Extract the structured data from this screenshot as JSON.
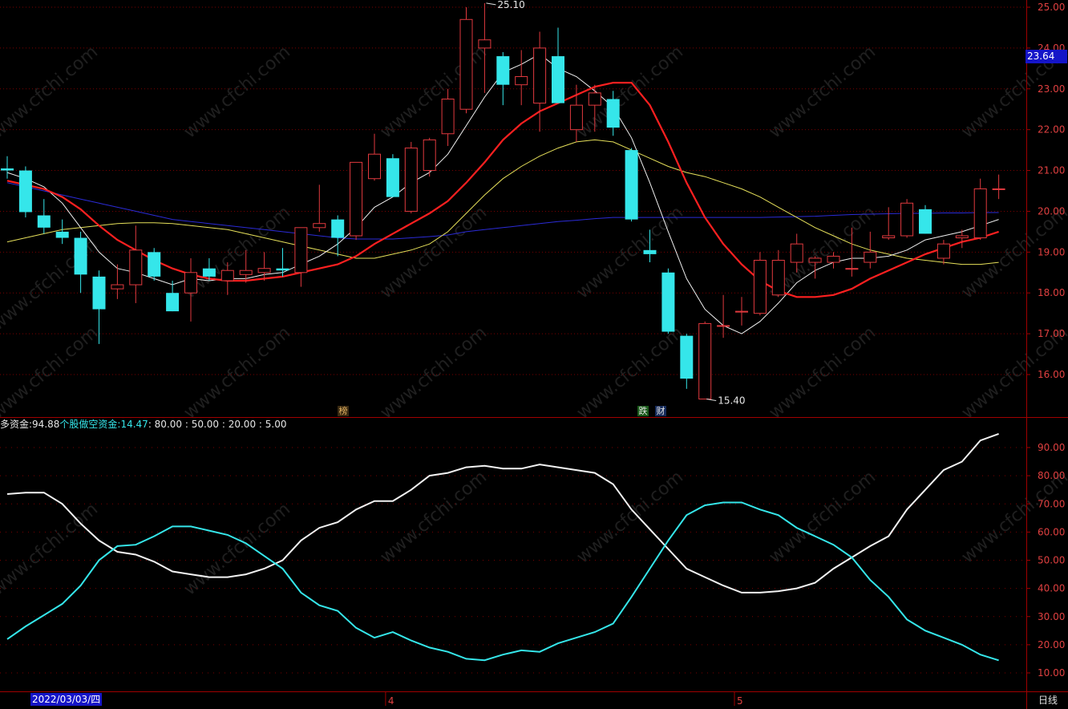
{
  "watermark": "www.cfchi.com",
  "colors": {
    "background": "#000000",
    "up": "#e0393e",
    "down": "#35e6ea",
    "grid": "#7a0000",
    "axis": "#a00000",
    "ma5": "#f0f0f0",
    "ma10": "#ff2020",
    "ma20": "#e6e05a",
    "ma60": "#2b2bd6",
    "axis_text": "#e04040"
  },
  "legend": {
    "prefix": "多资金: ",
    "long_value": "94.88",
    "short_label": " 个股做空资金: ",
    "short_value": "14.47",
    "levels_text": " : 80.00 : 50.00 : 20.00 : 5.00"
  },
  "last_price": "23.64",
  "period": "日线",
  "cursor_date": "2022/03/03/四",
  "event_markers": {
    "bang": "榜",
    "die": "跌",
    "cai": "财"
  },
  "chart_data": [
    {
      "type": "candlestick",
      "ylim": [
        15.0,
        25.2
      ],
      "y_ticks": [
        16.0,
        17.0,
        18.0,
        19.0,
        20.0,
        21.0,
        22.0,
        23.0,
        24.0,
        25.0
      ],
      "y_tick_labels": [
        "16.00",
        "17.00",
        "18.00",
        "19.00",
        "20.00",
        "21.00",
        "22.00",
        "23.00",
        "24.00",
        "25.00"
      ],
      "x_tick_labels": [
        "4",
        "5"
      ],
      "x_tick_index": [
        21,
        40
      ],
      "annotations": [
        {
          "text": "25.10",
          "index": 26,
          "value": 25.1
        },
        {
          "text": "15.40",
          "index": 38,
          "value": 15.4
        }
      ],
      "candles": [
        {
          "o": 21.05,
          "h": 21.35,
          "l": 20.8,
          "c": 21.0
        },
        {
          "o": 21.0,
          "h": 21.1,
          "l": 19.85,
          "c": 19.98
        },
        {
          "o": 19.9,
          "h": 20.3,
          "l": 19.45,
          "c": 19.6
        },
        {
          "o": 19.5,
          "h": 19.8,
          "l": 19.2,
          "c": 19.35
        },
        {
          "o": 19.35,
          "h": 19.5,
          "l": 18.0,
          "c": 18.45
        },
        {
          "o": 18.4,
          "h": 18.55,
          "l": 16.75,
          "c": 17.6
        },
        {
          "o": 18.1,
          "h": 18.7,
          "l": 17.85,
          "c": 18.2
        },
        {
          "o": 18.2,
          "h": 19.65,
          "l": 17.75,
          "c": 19.05
        },
        {
          "o": 19.0,
          "h": 19.1,
          "l": 18.3,
          "c": 18.4
        },
        {
          "o": 18.0,
          "h": 18.3,
          "l": 17.55,
          "c": 17.55
        },
        {
          "o": 18.0,
          "h": 18.85,
          "l": 17.3,
          "c": 18.5
        },
        {
          "o": 18.6,
          "h": 18.85,
          "l": 18.3,
          "c": 18.4
        },
        {
          "o": 18.3,
          "h": 18.75,
          "l": 17.95,
          "c": 18.55
        },
        {
          "o": 18.45,
          "h": 19.05,
          "l": 18.25,
          "c": 18.55
        },
        {
          "o": 18.5,
          "h": 19.0,
          "l": 18.3,
          "c": 18.6
        },
        {
          "o": 18.6,
          "h": 19.1,
          "l": 18.4,
          "c": 18.55
        },
        {
          "o": 18.5,
          "h": 19.6,
          "l": 18.15,
          "c": 19.6
        },
        {
          "o": 19.6,
          "h": 20.65,
          "l": 19.5,
          "c": 19.7
        },
        {
          "o": 19.8,
          "h": 19.9,
          "l": 18.9,
          "c": 19.35
        },
        {
          "o": 19.4,
          "h": 21.2,
          "l": 19.3,
          "c": 21.2
        },
        {
          "o": 20.8,
          "h": 21.9,
          "l": 20.75,
          "c": 21.4
        },
        {
          "o": 21.3,
          "h": 21.4,
          "l": 20.35,
          "c": 20.35
        },
        {
          "o": 20.0,
          "h": 21.7,
          "l": 19.95,
          "c": 21.55
        },
        {
          "o": 21.0,
          "h": 21.8,
          "l": 20.85,
          "c": 21.75
        },
        {
          "o": 21.9,
          "h": 23.0,
          "l": 21.6,
          "c": 22.75
        },
        {
          "o": 22.5,
          "h": 25.0,
          "l": 22.4,
          "c": 24.7
        },
        {
          "o": 24.0,
          "h": 25.1,
          "l": 22.9,
          "c": 24.2
        },
        {
          "o": 23.8,
          "h": 23.9,
          "l": 22.6,
          "c": 23.1
        },
        {
          "o": 23.1,
          "h": 23.95,
          "l": 22.6,
          "c": 23.3
        },
        {
          "o": 22.65,
          "h": 24.4,
          "l": 21.95,
          "c": 24.0
        },
        {
          "o": 23.8,
          "h": 24.5,
          "l": 22.65,
          "c": 22.65
        },
        {
          "o": 22.0,
          "h": 23.1,
          "l": 21.7,
          "c": 22.6
        },
        {
          "o": 22.6,
          "h": 23.1,
          "l": 21.95,
          "c": 22.9
        },
        {
          "o": 22.75,
          "h": 22.95,
          "l": 21.85,
          "c": 22.05
        },
        {
          "o": 21.5,
          "h": 21.55,
          "l": 19.75,
          "c": 19.8
        },
        {
          "o": 19.05,
          "h": 19.55,
          "l": 18.75,
          "c": 18.95
        },
        {
          "o": 18.5,
          "h": 18.6,
          "l": 17.0,
          "c": 17.05
        },
        {
          "o": 16.95,
          "h": 17.0,
          "l": 15.65,
          "c": 15.9
        },
        {
          "o": 15.4,
          "h": 17.3,
          "l": 15.4,
          "c": 17.25
        },
        {
          "o": 17.2,
          "h": 17.95,
          "l": 16.9,
          "c": 17.2
        },
        {
          "o": 17.55,
          "h": 17.9,
          "l": 17.2,
          "c": 17.55
        },
        {
          "o": 17.5,
          "h": 19.0,
          "l": 17.45,
          "c": 18.8
        },
        {
          "o": 17.95,
          "h": 19.05,
          "l": 17.9,
          "c": 18.8
        },
        {
          "o": 18.75,
          "h": 19.45,
          "l": 18.5,
          "c": 19.2
        },
        {
          "o": 18.75,
          "h": 18.9,
          "l": 18.35,
          "c": 18.85
        },
        {
          "o": 18.75,
          "h": 19.0,
          "l": 18.6,
          "c": 18.9
        },
        {
          "o": 18.6,
          "h": 19.6,
          "l": 18.4,
          "c": 18.6
        },
        {
          "o": 18.75,
          "h": 19.5,
          "l": 18.6,
          "c": 19.0
        },
        {
          "o": 19.35,
          "h": 20.1,
          "l": 19.3,
          "c": 19.4
        },
        {
          "o": 19.4,
          "h": 20.3,
          "l": 19.35,
          "c": 20.2
        },
        {
          "o": 20.05,
          "h": 20.15,
          "l": 19.45,
          "c": 19.45
        },
        {
          "o": 18.85,
          "h": 19.3,
          "l": 18.7,
          "c": 19.2
        },
        {
          "o": 19.35,
          "h": 19.55,
          "l": 19.1,
          "c": 19.4
        },
        {
          "o": 19.35,
          "h": 20.8,
          "l": 19.3,
          "c": 20.55
        },
        {
          "o": 20.55,
          "h": 20.9,
          "l": 20.3,
          "c": 20.55
        }
      ],
      "series": [
        {
          "key": "ma5",
          "values": [
            20.95,
            20.8,
            20.6,
            20.2,
            19.6,
            19.0,
            18.6,
            18.5,
            18.35,
            18.2,
            18.35,
            18.3,
            18.35,
            18.35,
            18.45,
            18.5,
            18.7,
            18.9,
            19.2,
            19.6,
            20.1,
            20.35,
            20.7,
            20.95,
            21.4,
            22.1,
            22.8,
            23.4,
            23.6,
            23.85,
            23.5,
            23.3,
            22.95,
            22.55,
            21.8,
            20.7,
            19.5,
            18.35,
            17.6,
            17.2,
            17.0,
            17.3,
            17.75,
            18.25,
            18.55,
            18.75,
            18.85,
            18.85,
            18.9,
            19.05,
            19.3,
            19.4,
            19.5,
            19.65,
            19.8
          ]
        },
        {
          "key": "ma10",
          "values": [
            20.75,
            20.65,
            20.55,
            20.35,
            20.05,
            19.65,
            19.3,
            19.05,
            18.8,
            18.6,
            18.45,
            18.35,
            18.3,
            18.3,
            18.35,
            18.4,
            18.5,
            18.6,
            18.7,
            18.9,
            19.2,
            19.45,
            19.7,
            19.95,
            20.25,
            20.7,
            21.2,
            21.75,
            22.15,
            22.45,
            22.65,
            22.85,
            23.05,
            23.15,
            23.15,
            22.6,
            21.7,
            20.7,
            19.85,
            19.2,
            18.7,
            18.3,
            18.05,
            17.9,
            17.9,
            17.95,
            18.1,
            18.35,
            18.55,
            18.75,
            18.95,
            19.1,
            19.25,
            19.35,
            19.5
          ]
        },
        {
          "key": "ma20",
          "values": [
            19.25,
            19.35,
            19.45,
            19.55,
            19.6,
            19.65,
            19.7,
            19.72,
            19.72,
            19.7,
            19.65,
            19.6,
            19.55,
            19.45,
            19.35,
            19.25,
            19.15,
            19.05,
            18.95,
            18.85,
            18.85,
            18.95,
            19.05,
            19.2,
            19.5,
            19.95,
            20.4,
            20.8,
            21.1,
            21.35,
            21.55,
            21.7,
            21.75,
            21.7,
            21.5,
            21.3,
            21.1,
            20.95,
            20.85,
            20.7,
            20.55,
            20.35,
            20.1,
            19.85,
            19.6,
            19.4,
            19.2,
            19.05,
            18.95,
            18.85,
            18.8,
            18.75,
            18.7,
            18.7,
            18.75
          ]
        },
        {
          "key": "ma60",
          "values": [
            20.7,
            20.6,
            20.5,
            20.4,
            20.3,
            20.2,
            20.1,
            20.0,
            19.9,
            19.8,
            19.75,
            19.7,
            19.65,
            19.6,
            19.55,
            19.5,
            19.45,
            19.4,
            19.35,
            19.32,
            19.32,
            19.32,
            19.35,
            19.38,
            19.42,
            19.5,
            19.55,
            19.6,
            19.65,
            19.7,
            19.75,
            19.78,
            19.82,
            19.85,
            19.85,
            19.85,
            19.85,
            19.85,
            19.85,
            19.85,
            19.85,
            19.85,
            19.86,
            19.87,
            19.88,
            19.9,
            19.92,
            19.93,
            19.94,
            19.95,
            19.95,
            19.96,
            19.96,
            19.97,
            19.97
          ]
        }
      ]
    },
    {
      "type": "line",
      "ylim": [
        3.0,
        100.0
      ],
      "y_ticks": [
        10,
        20,
        30,
        40,
        50,
        60,
        70,
        80,
        90
      ],
      "y_tick_labels": [
        "10.00",
        "20.00",
        "30.00",
        "40.00",
        "50.00",
        "60.00",
        "70.00",
        "80.00",
        "90.00"
      ],
      "series": [
        {
          "key": "long",
          "name": "多资金",
          "values": [
            73.5,
            74.0,
            74.0,
            70.0,
            63.0,
            57.0,
            53.0,
            52.0,
            49.5,
            46.0,
            45.0,
            44.0,
            44.0,
            45.0,
            47.0,
            50.0,
            57.0,
            61.5,
            63.5,
            68.0,
            71.0,
            71.0,
            75.0,
            80.0,
            81.0,
            83.0,
            83.5,
            82.5,
            82.5,
            84.0,
            83.0,
            82.0,
            81.0,
            77.0,
            68.0,
            61.0,
            54.0,
            47.0,
            44.0,
            41.0,
            38.5,
            38.5,
            39.0,
            40.0,
            42.0,
            47.0,
            51.0,
            55.0,
            58.5,
            68.0,
            75.0,
            82.0,
            85.0,
            92.5,
            94.88
          ]
        },
        {
          "key": "short",
          "name": "个股做空资金",
          "values": [
            22.0,
            26.5,
            30.5,
            34.5,
            41.0,
            50.0,
            55.0,
            55.5,
            58.5,
            62.0,
            62.0,
            60.5,
            59.0,
            56.0,
            51.5,
            47.0,
            38.5,
            34.0,
            32.0,
            26.0,
            22.5,
            24.5,
            21.5,
            19.0,
            17.5,
            15.0,
            14.5,
            16.5,
            18.0,
            17.5,
            20.5,
            22.5,
            24.5,
            27.5,
            37.0,
            47.0,
            57.0,
            66.0,
            69.5,
            70.5,
            70.5,
            68.0,
            66.0,
            61.5,
            58.5,
            55.5,
            51.0,
            43.0,
            37.0,
            29.0,
            25.0,
            22.5,
            20.0,
            16.5,
            14.47
          ]
        }
      ]
    }
  ]
}
